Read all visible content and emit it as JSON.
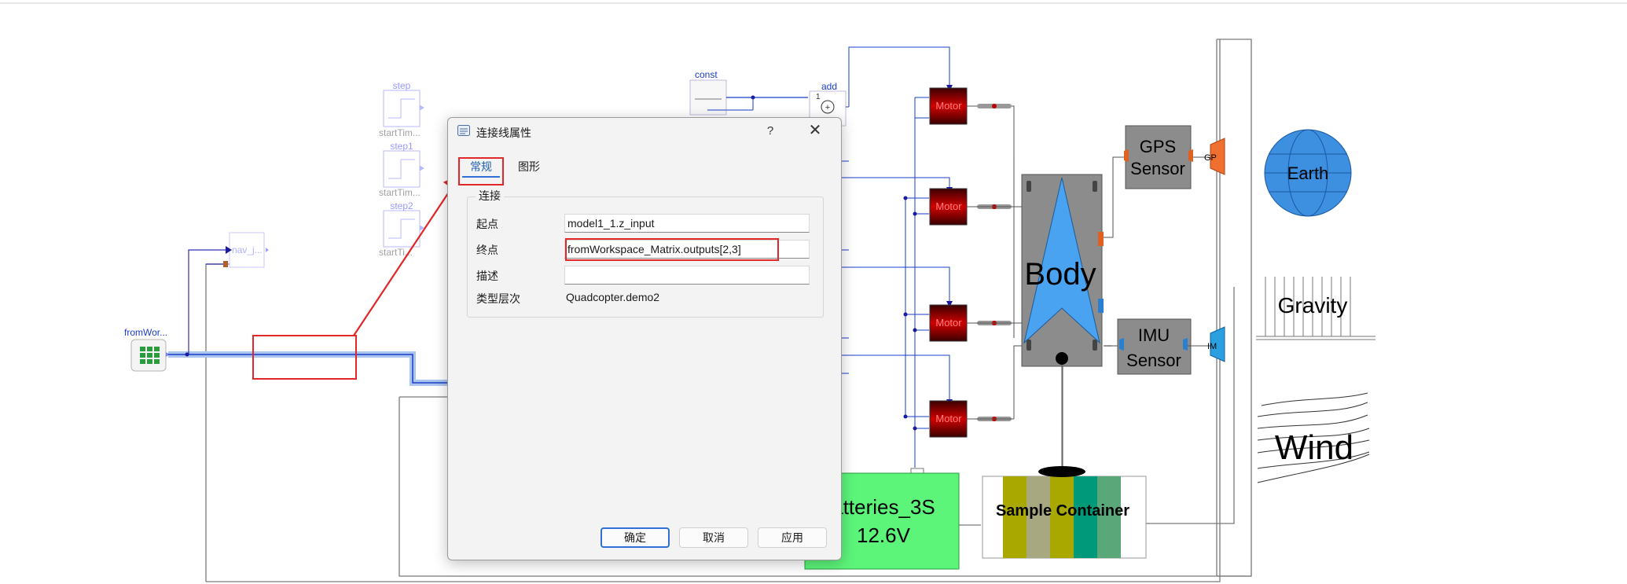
{
  "diagram": {
    "blocks": {
      "step": {
        "name": "step",
        "param": "startTim..."
      },
      "step1": {
        "name": "step1",
        "param": "startTim..."
      },
      "step2": {
        "name": "step2",
        "param": "startTi..."
      },
      "nav": {
        "name": "nav_j..."
      },
      "from_workspace": {
        "name": "fromWor..."
      },
      "const": {
        "name": "const"
      },
      "add": {
        "name": "add",
        "symbol": "+",
        "port_label": "1"
      },
      "motor": {
        "label": "Motor"
      },
      "body": {
        "label": "Body"
      },
      "gps": {
        "line1": "GPS",
        "line2": "Sensor",
        "port": "GP"
      },
      "imu": {
        "line1": "IMU",
        "line2": "Sensor",
        "port": "IM"
      },
      "earth": {
        "label": "Earth"
      },
      "gravity": {
        "label": "Gravity"
      },
      "wind": {
        "label": "Wind"
      },
      "battery": {
        "line1": "atteries_3S",
        "line2": "12.6V"
      },
      "sample": {
        "label": "Sample Container"
      }
    },
    "colors": {
      "motor_red": "#b80000",
      "body_gray": "#8c8c8c",
      "body_arrow": "#4aa3f0",
      "battery_green": "#5cf57a",
      "earth_blue": "#3d8fe0",
      "connector_blue": "#1a3cc8",
      "highlight_red": "#e12727"
    }
  },
  "dialog": {
    "title": "连接线属性",
    "help": "?",
    "close": "✕",
    "tabs": [
      {
        "label": "常规",
        "active": true
      },
      {
        "label": "图形",
        "active": false
      }
    ],
    "group_title": "连接",
    "fields": {
      "start": {
        "label": "起点",
        "value": "model1_1.z_input"
      },
      "end": {
        "label": "终点",
        "value": "fromWorkspace_Matrix.outputs[2,3]"
      },
      "description": {
        "label": "描述",
        "value": ""
      },
      "type_level": {
        "label": "类型层次",
        "value": "Quadcopter.demo2"
      }
    },
    "buttons": {
      "ok": "确定",
      "cancel": "取消",
      "apply": "应用"
    }
  }
}
